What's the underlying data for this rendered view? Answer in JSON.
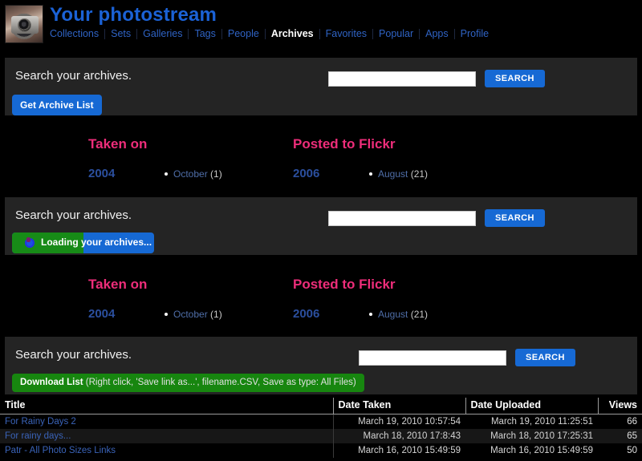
{
  "header": {
    "title": "Your photostream",
    "avatar_alt": "user-avatar-camera-photo",
    "nav": [
      {
        "label": "Collections",
        "active": false
      },
      {
        "label": "Sets",
        "active": false
      },
      {
        "label": "Galleries",
        "active": false
      },
      {
        "label": "Tags",
        "active": false
      },
      {
        "label": "People",
        "active": false
      },
      {
        "label": "Archives",
        "active": true
      },
      {
        "label": "Favorites",
        "active": false
      },
      {
        "label": "Popular",
        "active": false
      },
      {
        "label": "Apps",
        "active": false
      },
      {
        "label": "Profile",
        "active": false
      }
    ]
  },
  "panels": {
    "search_label": "Search your archives.",
    "search_value": "",
    "search_placeholder": "",
    "search_button": "SEARCH",
    "get_archive_list_button": "Get Archive List",
    "loading_button": {
      "label": "Loading your archives...",
      "progress_percent": 50,
      "fill_color": "#178b17",
      "track_color": "#1669d4"
    },
    "download_button": {
      "strong": "Download List",
      "hint": "(Right click, 'Save link as...', filename.CSV, Save as type: All Files)",
      "color": "#17860f"
    }
  },
  "archives": [
    {
      "columns": [
        {
          "heading": "Taken on",
          "heading_color": "#ee2d7a",
          "year": "2004",
          "months": [
            {
              "name": "October",
              "count": "(1)"
            }
          ]
        },
        {
          "heading": "Posted to Flickr",
          "heading_color": "#ee2d7a",
          "year": "2006",
          "months": [
            {
              "name": "August",
              "count": "(21)"
            }
          ]
        }
      ]
    },
    {
      "columns": [
        {
          "heading": "Taken on",
          "heading_color": "#ee2d7a",
          "year": "2004",
          "months": [
            {
              "name": "October",
              "count": "(1)"
            }
          ]
        },
        {
          "heading": "Posted to Flickr",
          "heading_color": "#ee2d7a",
          "year": "2006",
          "months": [
            {
              "name": "August",
              "count": "(21)"
            }
          ]
        }
      ]
    }
  ],
  "results": {
    "headers": {
      "title": "Title",
      "date_taken": "Date Taken",
      "date_uploaded": "Date Uploaded",
      "views": "Views"
    },
    "rows": [
      {
        "title": "For Rainy Days 2",
        "date_taken": "March 19, 2010 10:57:54",
        "date_uploaded": "March 19, 2010 11:25:51",
        "views": "66"
      },
      {
        "title": "For rainy days...",
        "date_taken": "March 18, 2010 17:8:43",
        "date_uploaded": "March 18, 2010 17:25:31",
        "views": "65"
      },
      {
        "title": "Patr - All Photo Sizes Links",
        "date_taken": "March 16, 2010 15:49:59",
        "date_uploaded": "March 16, 2010 15:49:59",
        "views": "50"
      }
    ]
  }
}
